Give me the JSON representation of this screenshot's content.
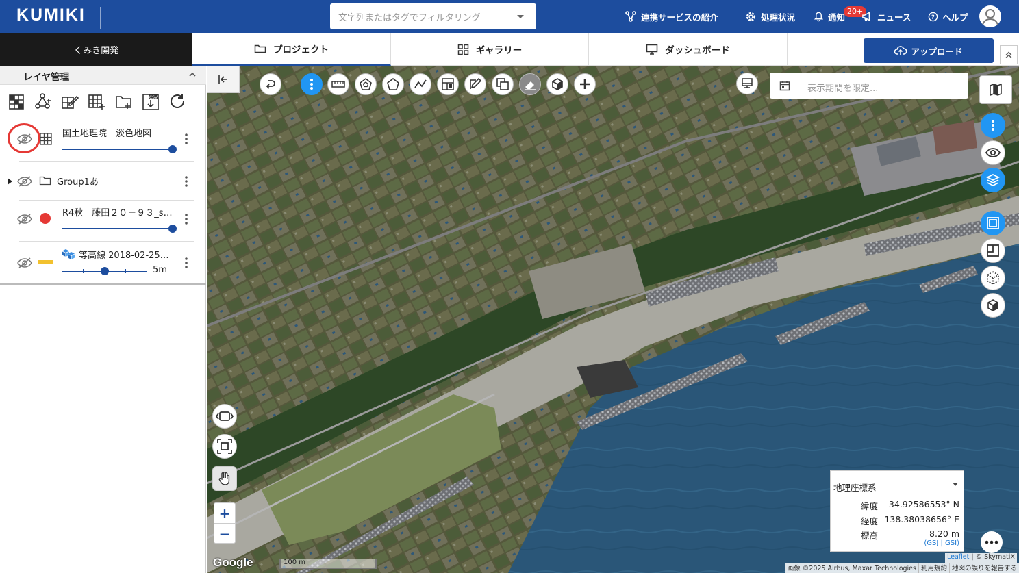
{
  "header": {
    "logo": "KUMIKI",
    "search_placeholder": "文字列またはタグでフィルタリング",
    "nav": {
      "services": "連携サービスの紹介",
      "processing": "処理状況",
      "notifications": "通知",
      "notification_badge": "20+",
      "news": "ニュース",
      "help": "ヘルプ"
    }
  },
  "subbar": {
    "project_name": "くみき開発",
    "tabs": [
      "プロジェクト",
      "ギャラリー",
      "ダッシュボード"
    ],
    "upload_label": "アップロード"
  },
  "panel": {
    "title": "レイヤ管理",
    "layers": [
      {
        "name": "国土地理院　淡色地図",
        "type": "tile"
      },
      {
        "name": "Group1あ",
        "type": "group"
      },
      {
        "name": "R4秋　藤田２０－９３_s…",
        "type": "point",
        "color": "#e53935"
      },
      {
        "name": "等高線 2018-02-25…",
        "type": "contour",
        "color": "#f2c12e",
        "step_label": "5m"
      }
    ]
  },
  "map": {
    "date_placeholder": "表示期間を限定...",
    "coordinate_panel": {
      "system": "地理座標系",
      "lat_label": "緯度",
      "lat_value": "34.92586553° N",
      "lon_label": "経度",
      "lon_value": "138.38038656° E",
      "elev_label": "標高",
      "elev_value": "8.20 m",
      "link1": "GSJ",
      "link2": "GSI"
    },
    "google_logo": "Google",
    "scale_label": "100 m",
    "attribution": [
      "画像 ©2025 Airbus, Maxar Technologies",
      "利用規約",
      "地図の誤りを報告する"
    ],
    "leaflet": "Leaflet",
    "leaflet_credit": "© SkymatiX"
  },
  "colors": {
    "brand": "#1d4d9e",
    "accent": "#2196f3",
    "alert": "#e53935"
  }
}
